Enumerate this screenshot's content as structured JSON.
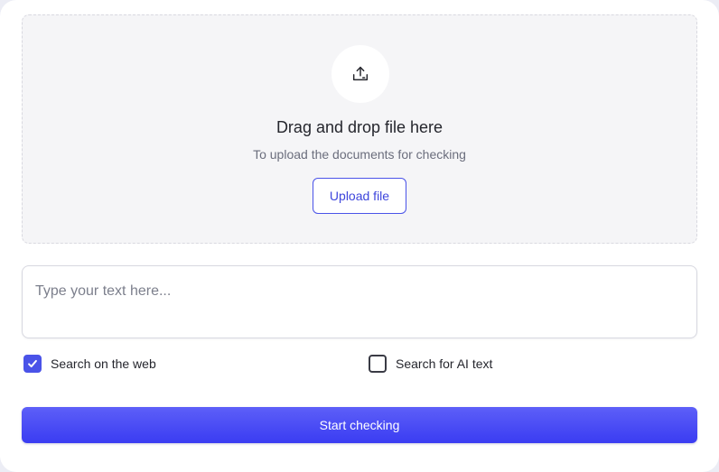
{
  "dropzone": {
    "icon": "upload-tray-icon",
    "title": "Drag and drop file here",
    "subtitle": "To upload the documents for checking",
    "upload_label": "Upload file"
  },
  "text_input": {
    "placeholder": "Type your text here...",
    "value": ""
  },
  "options": {
    "web": {
      "label": "Search on the web",
      "checked": true,
      "icon": "check-icon"
    },
    "ai": {
      "label": "Search for AI text",
      "checked": false
    }
  },
  "actions": {
    "start_label": "Start checking"
  },
  "colors": {
    "accent": "#4a53e8",
    "button_gradient_top": "#5d5ff8",
    "button_gradient_bottom": "#3a3cf2",
    "dropzone_bg": "#f5f5f7",
    "page_bg": "#ecedf5"
  }
}
